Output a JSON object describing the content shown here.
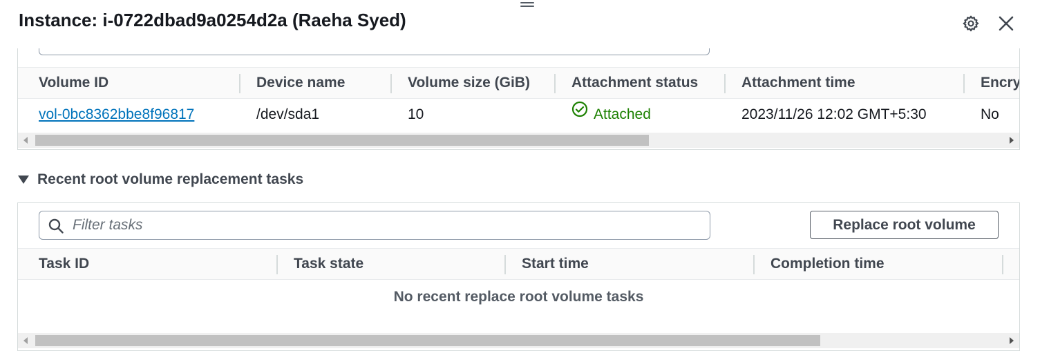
{
  "header": {
    "title": "Instance: i-0722dbad9a0254d2a (Raeha Syed)",
    "settings_icon": "gear-icon",
    "close_icon": "close-icon"
  },
  "volumes_table": {
    "columns": [
      "Volume ID",
      "Device name",
      "Volume size (GiB)",
      "Attachment status",
      "Attachment time",
      "Encry"
    ],
    "rows": [
      {
        "volume_id": "vol-0bc8362bbe8f96817",
        "device_name": "/dev/sda1",
        "size": "10",
        "status": "Attached",
        "attachment_time": "2023/11/26 12:02 GMT+5:30",
        "encrypted": "No"
      }
    ]
  },
  "tasks_section": {
    "title": "Recent root volume replacement tasks",
    "search_placeholder": "Filter tasks",
    "replace_button": "Replace root volume",
    "columns": [
      "Task ID",
      "Task state",
      "Start time",
      "Completion time"
    ],
    "empty_message": "No recent replace root volume tasks"
  },
  "colors": {
    "link": "#0073bb",
    "success": "#1d8102",
    "text": "#16191f",
    "header_text": "#414750"
  }
}
